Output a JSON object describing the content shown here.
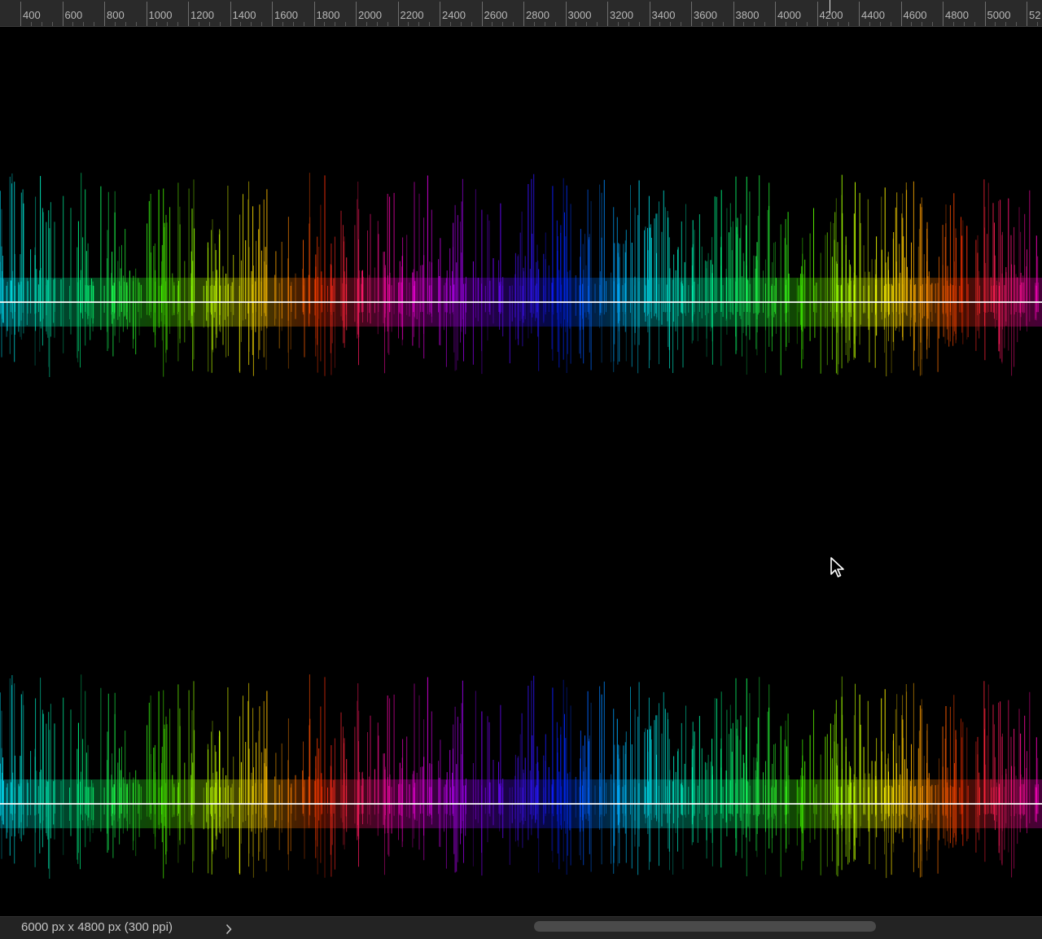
{
  "ruler": {
    "labels": [
      "400",
      "600",
      "800",
      "1000",
      "1200",
      "1400",
      "1600",
      "1800",
      "2000",
      "2200",
      "2400",
      "2600",
      "2800",
      "3000",
      "3200",
      "3400",
      "3600",
      "3800",
      "4000",
      "4200",
      "4400",
      "4600",
      "4800",
      "5000",
      "52"
    ]
  },
  "status": {
    "document_info": "6000 px x 4800 px (300 ppi)"
  },
  "colors": {
    "canvas_background": "#000000",
    "ruler_background": "#2a2a2a",
    "spectrum": [
      "#00e5ff",
      "#00ff88",
      "#44ff00",
      "#ffff00",
      "#ff3300",
      "#ff00cc",
      "#8800ff",
      "#0022ff",
      "#00e5ff",
      "#00ff88",
      "#44ff00",
      "#ffff00",
      "#ff3300",
      "#ff00cc"
    ]
  },
  "icons": {
    "cursor": "mouse-pointer-icon",
    "status_arrow": "chevron-right-icon"
  }
}
